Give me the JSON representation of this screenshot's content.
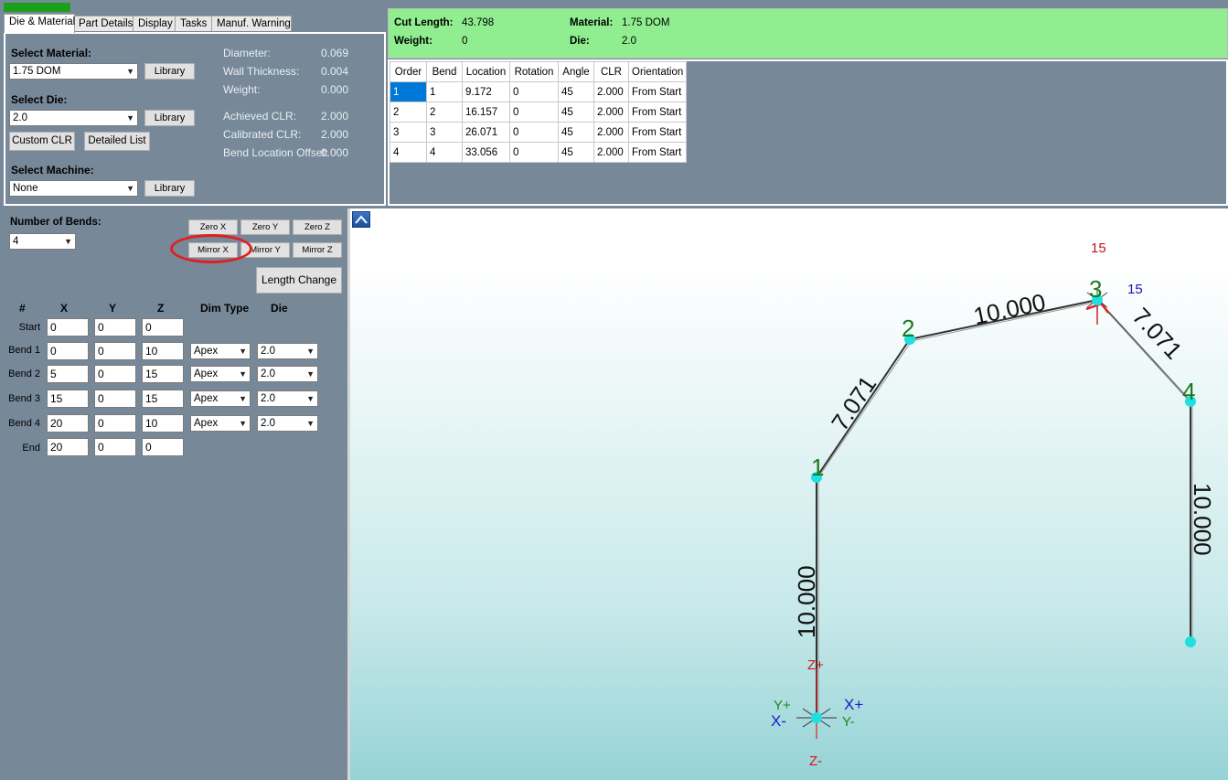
{
  "tabs": [
    "Die & Material",
    "Part Details",
    "Display",
    "Tasks",
    "Manuf. Warning"
  ],
  "material_section": {
    "select_material_label": "Select Material:",
    "material_value": "1.75 DOM",
    "library_label": "Library",
    "select_die_label": "Select Die:",
    "die_value": "2.0",
    "custom_clr_label": "Custom CLR",
    "detailed_list_label": "Detailed List",
    "select_machine_label": "Select Machine:",
    "machine_value": "None"
  },
  "properties": [
    {
      "label": "Diameter:",
      "value": "0.069"
    },
    {
      "label": "Wall Thickness:",
      "value": "0.004"
    },
    {
      "label": "Weight:",
      "value": "0.000"
    },
    {
      "label": "Achieved CLR:",
      "value": "2.000"
    },
    {
      "label": "Calibrated CLR:",
      "value": "2.000"
    },
    {
      "label": "Bend Location Offset:",
      "value": "0.000"
    }
  ],
  "summary": {
    "cut_length_label": "Cut Length:",
    "cut_length_value": "43.798",
    "weight_label": "Weight:",
    "weight_value": "0",
    "material_label": "Material:",
    "material_value": "1.75 DOM",
    "die_label": "Die:",
    "die_value": "2.0"
  },
  "bend_table": {
    "headers": [
      "Order",
      "Bend",
      "Location",
      "Rotation",
      "Angle",
      "CLR",
      "Orientation"
    ],
    "rows": [
      [
        "1",
        "1",
        "9.172",
        "0",
        "45",
        "2.000",
        "From Start"
      ],
      [
        "2",
        "2",
        "16.157",
        "0",
        "45",
        "2.000",
        "From Start"
      ],
      [
        "3",
        "3",
        "26.071",
        "0",
        "45",
        "2.000",
        "From Start"
      ],
      [
        "4",
        "4",
        "33.056",
        "0",
        "45",
        "2.000",
        "From Start"
      ]
    ]
  },
  "bends_section": {
    "number_of_bends_label": "Number of Bends:",
    "number_of_bends_value": "4",
    "zero_x": "Zero X",
    "zero_y": "Zero Y",
    "zero_z": "Zero Z",
    "mirror_x": "Mirror X",
    "mirror_y": "Mirror Y",
    "mirror_z": "Mirror Z",
    "length_change": "Length Change",
    "headers": [
      "#",
      "X",
      "Y",
      "Z",
      "Dim Type",
      "Die"
    ],
    "rows": [
      {
        "label": "Start",
        "x": "0",
        "y": "0",
        "z": "0",
        "dim": "",
        "die": ""
      },
      {
        "label": "Bend 1",
        "x": "0",
        "y": "0",
        "z": "10",
        "dim": "Apex",
        "die": "2.0"
      },
      {
        "label": "Bend 2",
        "x": "5",
        "y": "0",
        "z": "15",
        "dim": "Apex",
        "die": "2.0"
      },
      {
        "label": "Bend 3",
        "x": "15",
        "y": "0",
        "z": "15",
        "dim": "Apex",
        "die": "2.0"
      },
      {
        "label": "Bend 4",
        "x": "20",
        "y": "0",
        "z": "10",
        "dim": "Apex",
        "die": "2.0"
      },
      {
        "label": "End",
        "x": "20",
        "y": "0",
        "z": "0",
        "dim": "",
        "die": ""
      }
    ]
  },
  "viewport": {
    "node_labels": [
      "1",
      "2",
      "3",
      "4"
    ],
    "segment_labels": [
      "10.000",
      "7.071",
      "10.000",
      "7.071",
      "10.000"
    ],
    "angle_red": "15",
    "angle_blue": "15",
    "axes": {
      "z_plus": "Z+",
      "z_minus": "Z-",
      "x_plus": "X+",
      "x_minus": "X-",
      "y_plus": "Y+",
      "y_minus": "Y-"
    },
    "colors": {
      "node": "#1ee0e0",
      "node_label": "#1a7a1a",
      "highlight": "#e02020"
    }
  }
}
